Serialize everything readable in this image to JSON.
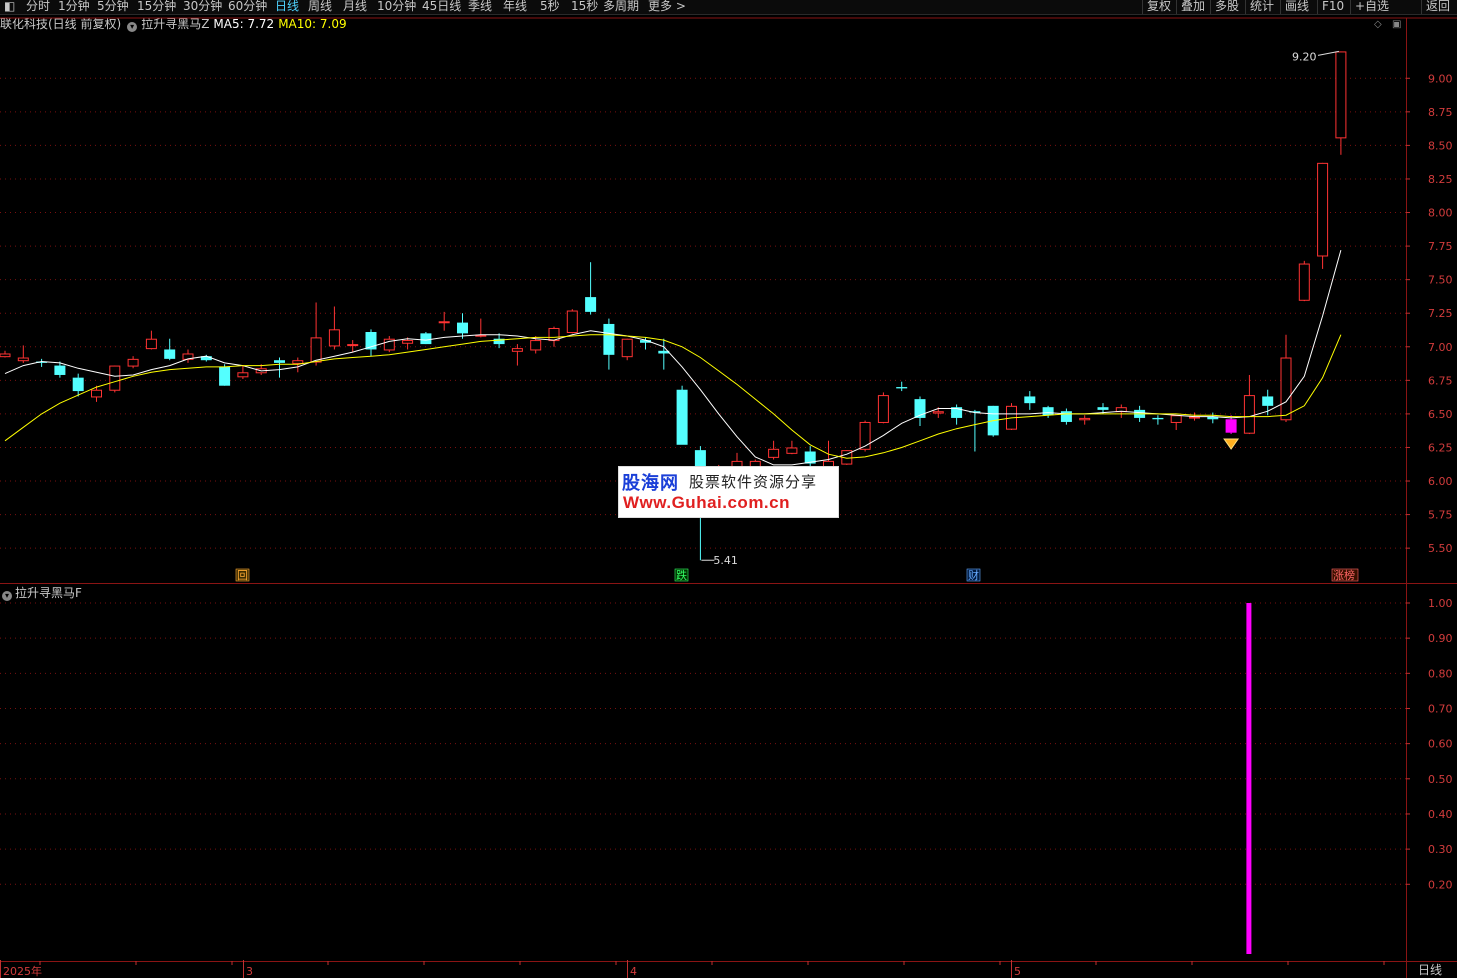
{
  "toolbar": {
    "left_items": [
      "分时",
      "1分钟",
      "5分钟",
      "15分钟",
      "30分钟",
      "60分钟",
      "日线",
      "周线",
      "月线",
      "10分钟",
      "45日线",
      "季线",
      "年线",
      "5秒",
      "15秒",
      "多周期",
      "更多 >"
    ],
    "active": "日线",
    "right_items": [
      "复权",
      "叠加",
      "多股",
      "统计",
      "画线",
      "F10",
      "+自选",
      "返回"
    ]
  },
  "info": {
    "stock": "联化科技(日线 前复权)",
    "indicator": "拉升寻黑马Z",
    "ma5": "MA5: 7.72",
    "ma10": "MA10: 7.09"
  },
  "sub_panel": {
    "title": "拉升寻黑马F"
  },
  "labels": {
    "high_mark": "9.20",
    "low_mark": "5.41",
    "period": "日线",
    "markers": [
      "回",
      "跌",
      "财",
      "涨榜"
    ],
    "x_ticks": [
      "2025年",
      "3",
      "4",
      "5"
    ]
  },
  "watermark": {
    "logo": "股海网",
    "sub": "股票软件资源分享",
    "url": "Www.Guhai.com.cn"
  },
  "colors": {
    "up": "#ff3333",
    "down": "#54ffff",
    "ma5": "#ffffff",
    "ma10": "#ffff00",
    "signal": "#ff00ff",
    "grid": "#7a1010"
  },
  "chart_data": {
    "type": "candlestick",
    "main": {
      "ylim": [
        5.3,
        9.3
      ],
      "yticks": [
        "9.00",
        "8.75",
        "8.50",
        "8.25",
        "8.00",
        "7.75",
        "7.50",
        "7.25",
        "7.00",
        "6.75",
        "6.50",
        "6.25",
        "6.00",
        "5.75",
        "5.50"
      ],
      "candles": [
        [
          6.93,
          6.97,
          6.92,
          6.95
        ],
        [
          6.9,
          7.01,
          6.88,
          6.92
        ],
        [
          6.89,
          6.91,
          6.85,
          6.88
        ],
        [
          6.86,
          6.89,
          6.77,
          6.79
        ],
        [
          6.77,
          6.8,
          6.63,
          6.67
        ],
        [
          6.63,
          6.71,
          6.59,
          6.68
        ],
        [
          6.68,
          6.86,
          6.66,
          6.86
        ],
        [
          6.86,
          6.93,
          6.84,
          6.91
        ],
        [
          6.99,
          7.12,
          6.98,
          7.06
        ],
        [
          6.98,
          7.06,
          6.9,
          6.91
        ],
        [
          6.91,
          6.98,
          6.88,
          6.95
        ],
        [
          6.93,
          6.94,
          6.89,
          6.9
        ],
        [
          6.85,
          6.87,
          6.71,
          6.71
        ],
        [
          6.78,
          6.86,
          6.76,
          6.81
        ],
        [
          6.81,
          6.87,
          6.79,
          6.84
        ],
        [
          6.9,
          6.92,
          6.77,
          6.88
        ],
        [
          6.88,
          6.92,
          6.81,
          6.9
        ],
        [
          6.89,
          7.33,
          6.86,
          7.07
        ],
        [
          7.01,
          7.3,
          6.98,
          7.13
        ],
        [
          7.02,
          7.05,
          6.96,
          7.02
        ],
        [
          7.11,
          7.13,
          6.93,
          6.98
        ],
        [
          6.98,
          7.08,
          6.96,
          7.06
        ],
        [
          7.03,
          7.07,
          6.98,
          7.05
        ],
        [
          7.1,
          7.11,
          7.02,
          7.02
        ],
        [
          7.19,
          7.26,
          7.12,
          7.19
        ],
        [
          7.18,
          7.25,
          7.06,
          7.1
        ],
        [
          7.09,
          7.21,
          7.07,
          7.09
        ],
        [
          7.06,
          7.1,
          6.99,
          7.02
        ],
        [
          6.97,
          7.02,
          6.86,
          6.99
        ],
        [
          6.98,
          7.08,
          6.95,
          7.05
        ],
        [
          7.05,
          7.15,
          7.0,
          7.14
        ],
        [
          7.11,
          7.28,
          7.1,
          7.27
        ],
        [
          7.37,
          7.63,
          7.24,
          7.26
        ],
        [
          7.17,
          7.21,
          6.83,
          6.94
        ],
        [
          6.93,
          7.06,
          6.9,
          7.06
        ],
        [
          7.05,
          7.07,
          6.98,
          7.03
        ],
        [
          6.97,
          7.06,
          6.83,
          6.95
        ],
        [
          6.68,
          6.71,
          6.41,
          6.27
        ],
        [
          6.23,
          6.26,
          5.41,
          6.1
        ],
        [
          6.05,
          6.12,
          6.0,
          6.1
        ],
        [
          6.1,
          6.21,
          6.02,
          6.15
        ],
        [
          6.1,
          6.16,
          6.0,
          6.15
        ],
        [
          6.18,
          6.3,
          6.16,
          6.24
        ],
        [
          6.21,
          6.3,
          6.2,
          6.25
        ],
        [
          6.22,
          6.26,
          6.08,
          6.13
        ],
        [
          6.08,
          6.3,
          6.08,
          6.15
        ],
        [
          6.13,
          6.23,
          6.12,
          6.23
        ],
        [
          6.24,
          6.45,
          6.22,
          6.44
        ],
        [
          6.44,
          6.66,
          6.43,
          6.64
        ],
        [
          6.7,
          6.74,
          6.67,
          6.69
        ],
        [
          6.61,
          6.63,
          6.41,
          6.47
        ],
        [
          6.51,
          6.55,
          6.47,
          6.52
        ],
        [
          6.55,
          6.57,
          6.42,
          6.47
        ],
        [
          6.52,
          6.53,
          6.22,
          6.51
        ],
        [
          6.56,
          6.56,
          6.33,
          6.34
        ],
        [
          6.39,
          6.58,
          6.38,
          6.56
        ],
        [
          6.63,
          6.67,
          6.53,
          6.58
        ],
        [
          6.55,
          6.56,
          6.47,
          6.49
        ],
        [
          6.52,
          6.54,
          6.42,
          6.44
        ],
        [
          6.46,
          6.49,
          6.42,
          6.47
        ],
        [
          6.55,
          6.58,
          6.5,
          6.53
        ],
        [
          6.52,
          6.57,
          6.47,
          6.55
        ],
        [
          6.53,
          6.56,
          6.44,
          6.47
        ],
        [
          6.47,
          6.49,
          6.42,
          6.46
        ],
        [
          6.44,
          6.48,
          6.38,
          6.49
        ],
        [
          6.48,
          6.51,
          6.45,
          6.48
        ],
        [
          6.48,
          6.51,
          6.43,
          6.46
        ],
        [
          6.46,
          6.49,
          6.35,
          6.36
        ],
        [
          6.36,
          6.79,
          6.35,
          6.64
        ],
        [
          6.63,
          6.68,
          6.49,
          6.56
        ],
        [
          6.46,
          7.09,
          6.44,
          6.92
        ],
        [
          7.35,
          7.64,
          7.34,
          7.62
        ],
        [
          7.68,
          8.37,
          7.58,
          8.37
        ],
        [
          8.56,
          9.2,
          8.43,
          9.2
        ]
      ],
      "ma5": [
        6.8,
        6.86,
        6.89,
        6.88,
        6.84,
        6.81,
        6.78,
        6.79,
        6.83,
        6.86,
        6.91,
        6.93,
        6.88,
        6.86,
        6.82,
        6.83,
        6.85,
        6.9,
        6.93,
        6.96,
        7.0,
        7.04,
        7.06,
        7.05,
        7.07,
        7.08,
        7.09,
        7.09,
        7.08,
        7.06,
        7.05,
        7.09,
        7.12,
        7.1,
        7.08,
        7.05,
        7.0,
        6.85,
        6.68,
        6.5,
        6.33,
        6.18,
        6.12,
        6.12,
        6.14,
        6.16,
        6.2,
        6.26,
        6.34,
        6.43,
        6.49,
        6.54,
        6.54,
        6.51,
        6.5,
        6.5,
        6.5,
        6.51,
        6.5,
        6.5,
        6.51,
        6.52,
        6.51,
        6.5,
        6.49,
        6.48,
        6.48,
        6.47,
        6.48,
        6.52,
        6.59,
        6.78,
        7.23,
        7.72
      ],
      "ma10": [
        6.3,
        6.4,
        6.5,
        6.58,
        6.64,
        6.7,
        6.74,
        6.78,
        6.81,
        6.83,
        6.84,
        6.85,
        6.85,
        6.86,
        6.86,
        6.87,
        6.87,
        6.89,
        6.91,
        6.92,
        6.93,
        6.94,
        6.96,
        6.98,
        7.0,
        7.02,
        7.04,
        7.05,
        7.06,
        7.07,
        7.07,
        7.08,
        7.09,
        7.09,
        7.08,
        7.07,
        7.05,
        7.0,
        6.92,
        6.82,
        6.72,
        6.61,
        6.5,
        6.38,
        6.27,
        6.2,
        6.17,
        6.18,
        6.21,
        6.25,
        6.3,
        6.35,
        6.39,
        6.42,
        6.45,
        6.47,
        6.48,
        6.49,
        6.5,
        6.5,
        6.5,
        6.5,
        6.5,
        6.5,
        6.5,
        6.49,
        6.49,
        6.48,
        6.48,
        6.48,
        6.49,
        6.56,
        6.77,
        7.09
      ]
    },
    "sub": {
      "ylim": [
        0,
        1.05
      ],
      "yticks": [
        "1.00",
        "0.90",
        "0.80",
        "0.70",
        "0.60",
        "0.50",
        "0.40",
        "0.30",
        "0.20"
      ],
      "signal_index": 68,
      "signal_value": 1.0
    }
  }
}
